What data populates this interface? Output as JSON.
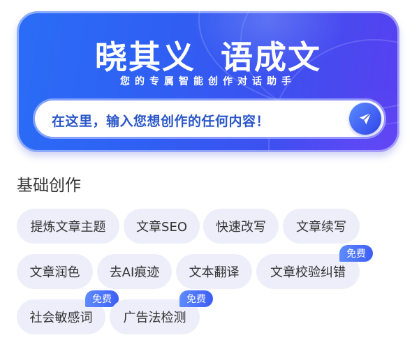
{
  "hero": {
    "title": "晓其义  语成文",
    "subtitle": "您的专属智能创作对话助手",
    "input_placeholder": "在这里，输入您想创作的任何内容！"
  },
  "section": {
    "title": "基础创作"
  },
  "chips": [
    {
      "label": "提炼文章主题",
      "badge": ""
    },
    {
      "label": "文章SEO",
      "badge": ""
    },
    {
      "label": "快速改写",
      "badge": ""
    },
    {
      "label": "文章续写",
      "badge": ""
    },
    {
      "label": "文章润色",
      "badge": ""
    },
    {
      "label": "去AI痕迹",
      "badge": ""
    },
    {
      "label": "文本翻译",
      "badge": ""
    },
    {
      "label": "文章校验纠错",
      "badge": "免费"
    },
    {
      "label": "社会敏感词",
      "badge": "免费"
    },
    {
      "label": "广告法检测",
      "badge": "免费"
    }
  ],
  "colors": {
    "brand_blue": "#2f5ff3",
    "chip_bg": "#eeeefb",
    "badge_blue": "#4a6ff8"
  }
}
